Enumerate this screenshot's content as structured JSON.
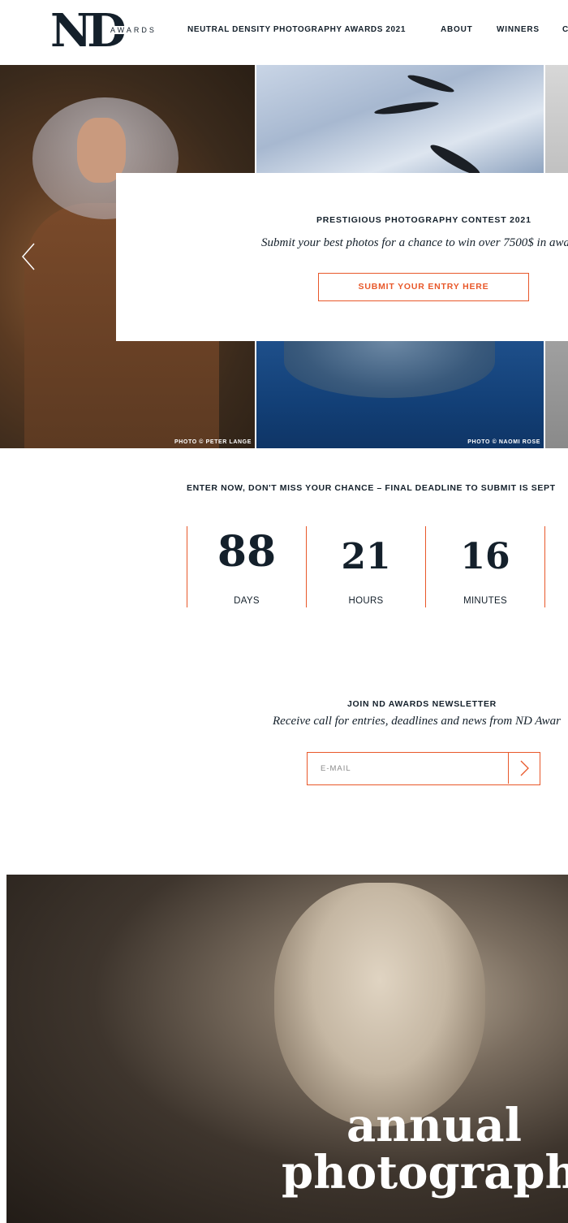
{
  "header": {
    "logo_main": "ND",
    "logo_sub": "AWARDS",
    "site_title": "NEUTRAL DENSITY PHOTOGRAPHY AWARDS 2021",
    "nav": [
      "ABOUT",
      "WINNERS",
      "C"
    ]
  },
  "hero": {
    "caption_left": "PHOTO © PETER LANGE",
    "caption_right": "PHOTO © NAOMI ROSE",
    "promo_heading": "PRESTIGIOUS PHOTOGRAPHY CONTEST 2021",
    "promo_sub": "Submit your best photos for a chance to win over 7500$ in awa",
    "promo_button": "SUBMIT YOUR ENTRY HERE"
  },
  "countdown": {
    "deadline_text": "ENTER NOW, DON'T MISS YOUR CHANCE – FINAL DEADLINE TO SUBMIT IS SEPT",
    "units": [
      {
        "value": "88",
        "label": "DAYS"
      },
      {
        "value": "21",
        "label": "HOURS"
      },
      {
        "value": "16",
        "label": "MINUTES"
      }
    ]
  },
  "newsletter": {
    "title": "JOIN ND AWARDS NEWSLETTER",
    "subtitle": "Receive call for entries, deadlines and news from ND Awar",
    "email_placeholder": "E-MAIL"
  },
  "feature": {
    "line1": "annual",
    "line2": "photography"
  },
  "colors": {
    "accent": "#e8582a",
    "text": "#14202b"
  }
}
